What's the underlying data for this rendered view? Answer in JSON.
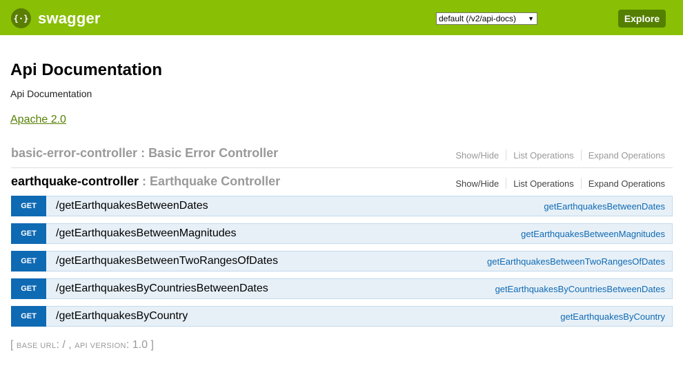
{
  "header": {
    "logo_text": "swagger",
    "logo_icon": "braces-icon",
    "spec_select": "default (/v2/api-docs)",
    "explore_label": "Explore",
    "brand_color": "#89bf04"
  },
  "info": {
    "title": "Api Documentation",
    "description": "Api Documentation",
    "license": "Apache 2.0"
  },
  "resources": [
    {
      "name": "basic-error-controller",
      "separator": " : ",
      "description": "Basic Error Controller",
      "show_hide": "Show/Hide",
      "list_operations": "List Operations",
      "expand_operations": "Expand Operations"
    },
    {
      "name": "earthquake-controller",
      "separator": " : ",
      "description": "Earthquake Controller",
      "show_hide": "Show/Hide",
      "list_operations": "List Operations",
      "expand_operations": "Expand Operations"
    }
  ],
  "operations": [
    {
      "method": "GET",
      "path": "/getEarthquakesBetweenDates",
      "nickname": "getEarthquakesBetweenDates"
    },
    {
      "method": "GET",
      "path": "/getEarthquakesBetweenMagnitudes",
      "nickname": "getEarthquakesBetweenMagnitudes"
    },
    {
      "method": "GET",
      "path": "/getEarthquakesBetweenTwoRangesOfDates",
      "nickname": "getEarthquakesBetweenTwoRangesOfDates"
    },
    {
      "method": "GET",
      "path": "/getEarthquakesByCountriesBetweenDates",
      "nickname": "getEarthquakesByCountriesBetweenDates"
    },
    {
      "method": "GET",
      "path": "/getEarthquakesByCountry",
      "nickname": "getEarthquakesByCountry"
    }
  ],
  "footer": {
    "open_bracket": "[",
    "base_url_label": "BASE URL",
    "base_url_value": ": / ,",
    "api_version_label": "API VERSION",
    "api_version_value": ": 1.0",
    "close_bracket": "]"
  }
}
